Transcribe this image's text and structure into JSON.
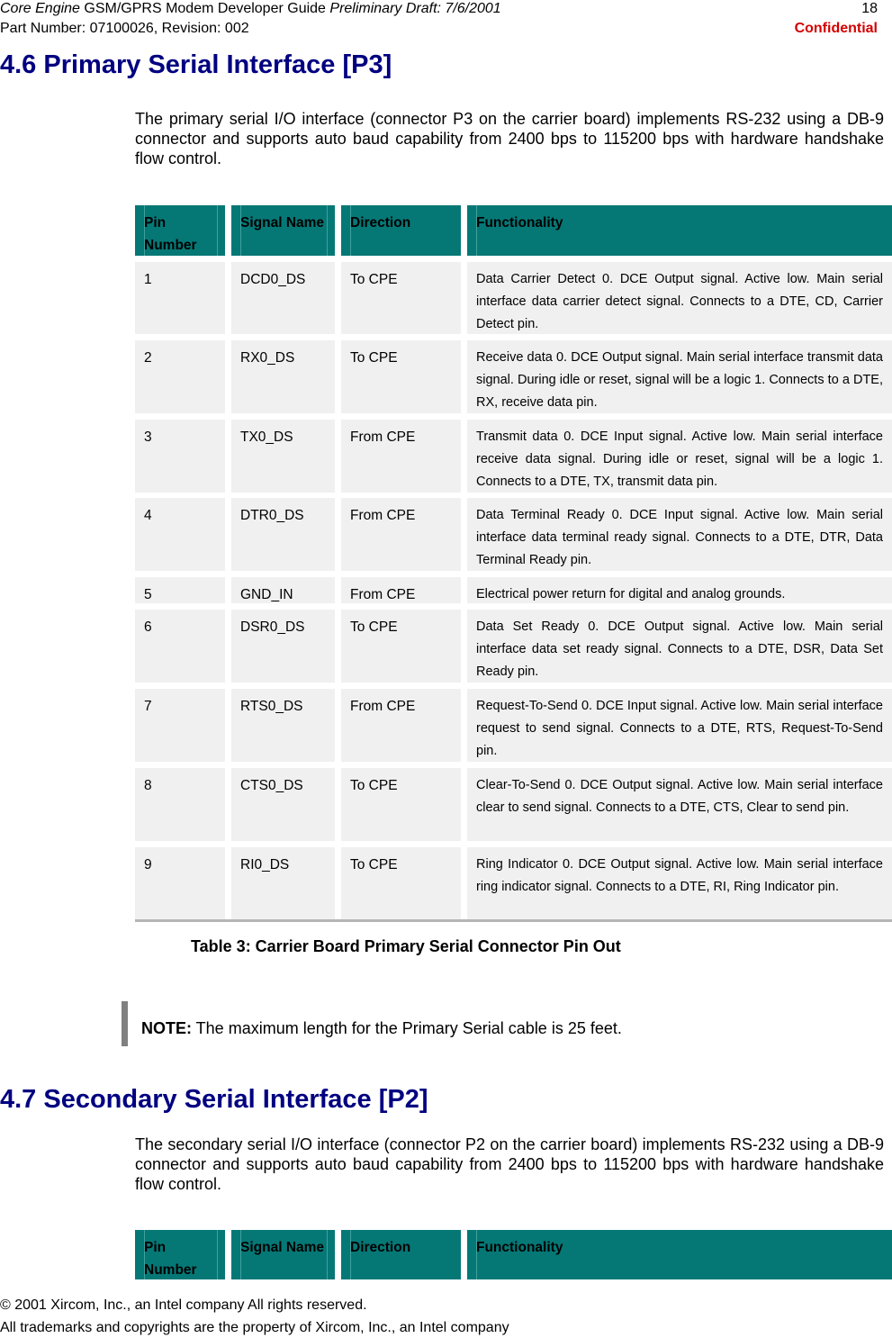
{
  "page_header": {
    "title_italic_1": "Core Engine",
    "title_plain": " GSM/GPRS Modem Developer Guide ",
    "title_italic_2": "Preliminary Draft: 7/6/2001",
    "page_number": "18",
    "part_number": "Part Number: 07100026, Revision: 002",
    "classification": "Confidential"
  },
  "colors": {
    "heading": "#000080",
    "table_header": "#057876",
    "table_cell": "#f0f0f0",
    "confidential": "#d40000"
  },
  "section_46": {
    "heading": "4.6 Primary Serial Interface [P3]",
    "body": "The primary serial I/O interface (connector P3 on the carrier board) implements RS-232 using a DB-9 connector and supports auto baud capability from 2400 bps to 115200 bps with hardware handshake flow control.",
    "table": {
      "headers": [
        "Pin Number",
        "Signal Name",
        "Direction",
        "Functionality"
      ],
      "rows": [
        {
          "pin": "1",
          "signal": "DCD0_DS",
          "direction": "To CPE",
          "function": "Data Carrier Detect 0. DCE Output signal. Active low. Main serial interface data carrier detect signal. Connects to a DTE, CD, Carrier Detect pin."
        },
        {
          "pin": "2",
          "signal": "RX0_DS",
          "direction": "To CPE",
          "function": "Receive data 0. DCE Output signal. Main serial interface transmit data signal. During idle or reset, signal will be a logic 1. Connects to a DTE, RX, receive data pin."
        },
        {
          "pin": "3",
          "signal": "TX0_DS",
          "direction": "From CPE",
          "function": "Transmit data 0. DCE Input signal. Active low. Main serial interface receive data signal. During idle or reset, signal will be a logic 1. Connects to a DTE, TX, transmit data pin."
        },
        {
          "pin": "4",
          "signal": "DTR0_DS",
          "direction": "From CPE",
          "function": "Data Terminal Ready 0. DCE Input signal. Active low. Main serial interface data terminal ready signal. Connects to a DTE, DTR, Data Terminal Ready pin."
        },
        {
          "pin": "5",
          "signal": "GND_IN",
          "direction": "From CPE",
          "function": "Electrical power return for digital and analog grounds."
        },
        {
          "pin": "6",
          "signal": "DSR0_DS",
          "direction": "To CPE",
          "function": "Data Set Ready 0. DCE Output signal. Active low. Main serial interface data set ready signal. Connects to a DTE, DSR, Data Set Ready pin."
        },
        {
          "pin": "7",
          "signal": "RTS0_DS",
          "direction": "From CPE",
          "function": "Request-To-Send 0. DCE Input signal. Active low. Main serial interface request to send signal. Connects to a DTE, RTS, Request-To-Send pin."
        },
        {
          "pin": "8",
          "signal": "CTS0_DS",
          "direction": "To CPE",
          "function": "Clear-To-Send 0. DCE Output signal. Active low. Main serial interface clear to send signal. Connects to a DTE, CTS, Clear to send pin."
        },
        {
          "pin": "9",
          "signal": "RI0_DS",
          "direction": "To CPE",
          "function": "Ring Indicator 0. DCE Output signal. Active low. Main serial interface ring indicator signal. Connects to a DTE, RI, Ring Indicator pin."
        }
      ],
      "caption": "Table 3: Carrier Board Primary Serial Connector Pin Out"
    },
    "note_label": "NOTE:",
    "note_text": " The maximum length for the Primary Serial cable is 25 feet."
  },
  "section_47": {
    "heading": "4.7 Secondary Serial Interface [P2]",
    "body": "The secondary serial I/O interface (connector P2 on the carrier board) implements RS-232 using a DB-9 connector and supports auto baud capability from 2400 bps to 115200 bps with hardware handshake flow control.",
    "table": {
      "headers": [
        "Pin Number",
        "Signal Name",
        "Direction",
        "Functionality"
      ]
    }
  },
  "page_footer": {
    "copyright": "© 2001 Xircom, Inc., an Intel company All rights reserved.",
    "trademarks": "All trademarks and copyrights are the property of Xircom, Inc., an Intel company"
  }
}
